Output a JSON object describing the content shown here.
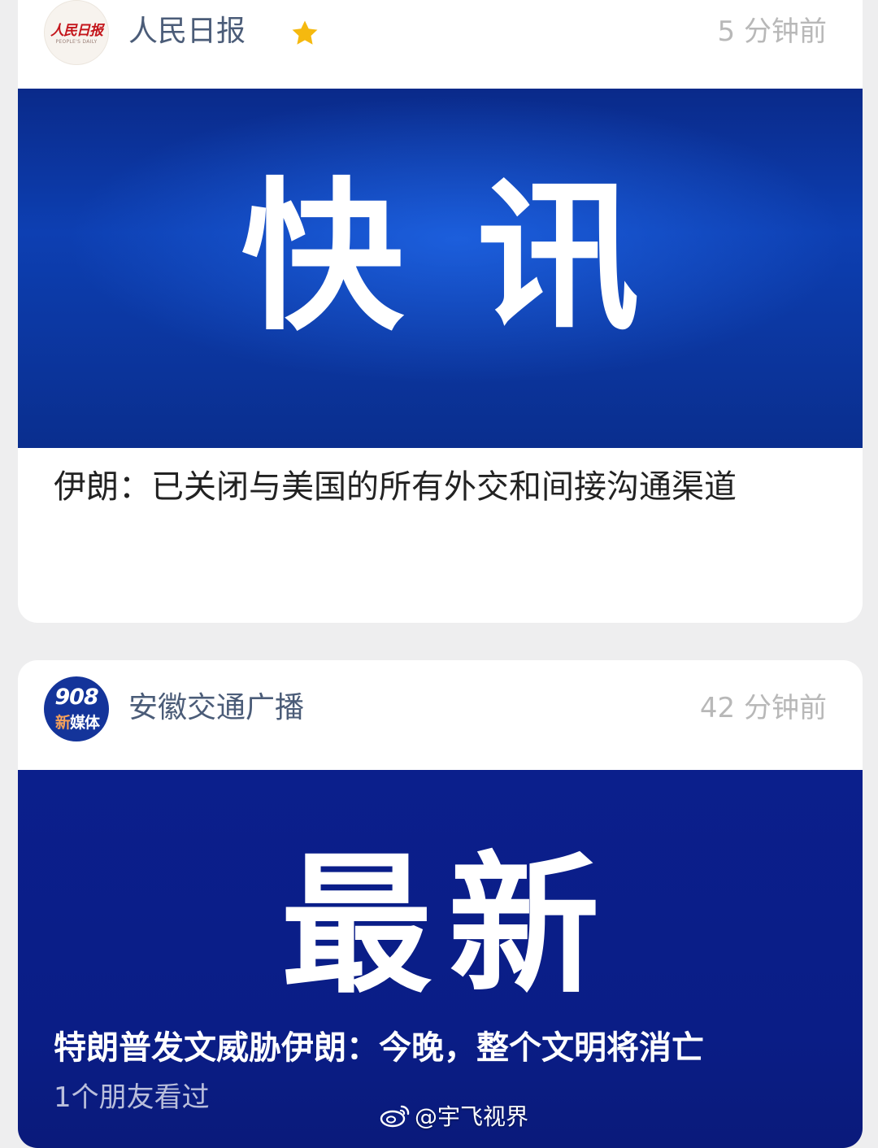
{
  "feed": [
    {
      "source": "人民日报",
      "avatar_text": "人民日报",
      "avatar_sub": "PEOPLE'S DAILY",
      "verified_icon": "star-icon",
      "time": "5 分钟前",
      "cover_text": "快讯",
      "headline": "伊朗：已关闭与美国的所有外交和间接沟通渠道"
    },
    {
      "source": "安徽交通广播",
      "avatar_num": "908",
      "avatar_tag_a": "新",
      "avatar_tag_b": "媒体",
      "time": "42 分钟前",
      "cover_text": "最新",
      "headline": "特朗普发文威胁伊朗：今晚，整个文明将消亡",
      "views": "1个朋友看过"
    }
  ],
  "watermark": "@宇飞视界",
  "colors": {
    "source_name": "#4b5c78",
    "timestamp": "#b8b8b8",
    "star": "#f5b90f",
    "cover_blue_1": "#0d3fb2",
    "cover_blue_2": "#0b1f8c"
  }
}
